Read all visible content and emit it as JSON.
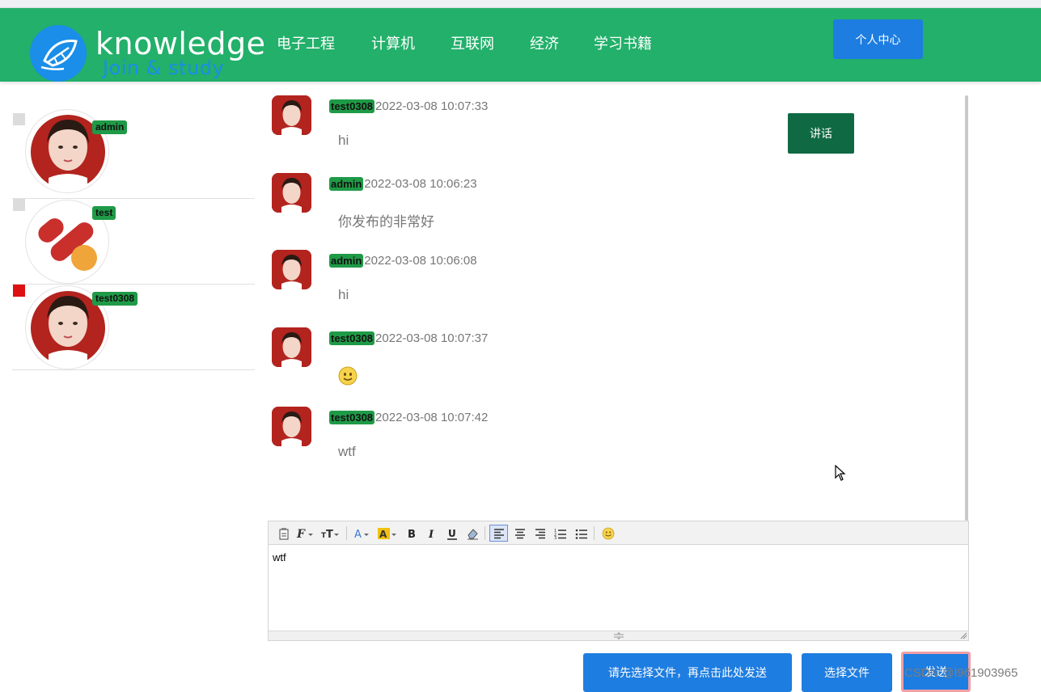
{
  "header": {
    "brand_title": "knowledge",
    "brand_subtitle": "Join & study",
    "nav_items": [
      "电子工程",
      "计算机",
      "互联网",
      "经济",
      "学习书籍"
    ],
    "profile_button": "个人中心",
    "background_color": "#22b06a"
  },
  "contacts": [
    {
      "name": "admin",
      "active": false
    },
    {
      "name": "test",
      "active": false
    },
    {
      "name": "test0308",
      "active": true
    }
  ],
  "messages": [
    {
      "sender": "test0308",
      "time": "2022-03-08 10:07:33",
      "text": "hi"
    },
    {
      "sender": "admin",
      "time": "2022-03-08 10:06:23",
      "text": "你发布的非常好"
    },
    {
      "sender": "admin",
      "time": "2022-03-08 10:06:08",
      "text": "hi"
    },
    {
      "sender": "test0308",
      "time": "2022-03-08 10:07:37",
      "text": "",
      "emoji": "smiley-face-icon"
    },
    {
      "sender": "test0308",
      "time": "2022-03-08 10:07:42",
      "text": "wtf"
    }
  ],
  "speak_button": "讲话",
  "editor": {
    "content": "wtf",
    "toolbar_icons": [
      "paste-icon",
      "font-family-icon",
      "font-size-icon",
      "font-color-icon",
      "highlight-color-icon",
      "bold-icon",
      "italic-icon",
      "underline-icon",
      "eraser-icon",
      "align-left-icon",
      "align-center-icon",
      "align-right-icon",
      "ordered-list-icon",
      "unordered-list-icon",
      "emoji-icon"
    ]
  },
  "buttons": {
    "send_file": "请先选择文件，再点击此处发送",
    "choose_file": "选择文件",
    "send": "发送"
  },
  "watermark": "CSDN @l961903965",
  "colors": {
    "badge_green": "#1f9a47",
    "button_blue": "#1e7de0",
    "speak_green": "#0f6a43",
    "active_marker": "#dd1111"
  }
}
